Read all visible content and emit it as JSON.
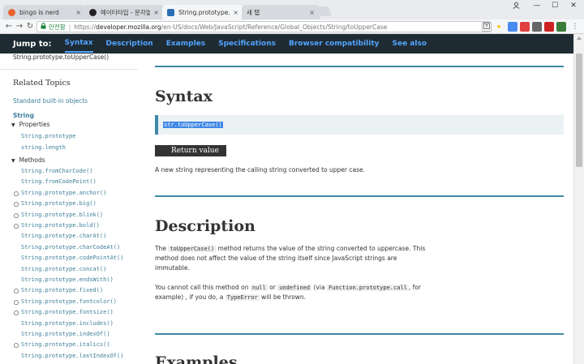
{
  "browser": {
    "tabs": [
      {
        "title": "bingo is nerd",
        "favicon_color": "#e8622c",
        "active": false
      },
      {
        "title": "메이터타입 - 문자열과",
        "favicon_color": "#222222",
        "active": false
      },
      {
        "title": "String.prototype.toUppe",
        "favicon_color": "#2a6eb5",
        "active": true
      },
      {
        "title": "새 탭",
        "favicon_color": "",
        "active": false
      }
    ],
    "tab_close": "×",
    "window_controls": {
      "minimize": "—",
      "maximize": "☐",
      "close": "✕"
    },
    "nav": {
      "back": "←",
      "forward": "→",
      "reload": "↻"
    },
    "address": {
      "secure_label": "안전함",
      "separator": "|",
      "scheme": "https://",
      "host": "developer.mozilla.org",
      "path": "/en-US/docs/Web/JavaScript/Reference/Global_Objects/String/toUpperCase"
    }
  },
  "jumpbar": {
    "label": "Jump to:",
    "links": [
      "Syntax",
      "Description",
      "Examples",
      "Specifications",
      "Browser compatibility",
      "See also"
    ]
  },
  "sidebar": {
    "breadcrumb_tail": "String.prototype.toUpperCase()",
    "related_title": "Related Topics",
    "standard_link": "Standard built-in objects",
    "object_name": "String",
    "properties_label": "Properties",
    "properties": [
      "String.prototype",
      "string.length"
    ],
    "methods_label": "Methods",
    "methods": [
      {
        "name": "String.fromCharCode()",
        "warn": false
      },
      {
        "name": "String.fromCodePoint()",
        "warn": false
      },
      {
        "name": "String.prototype.anchor()",
        "warn": true
      },
      {
        "name": "String.prototype.big()",
        "warn": true
      },
      {
        "name": "String.prototype.blink()",
        "warn": true
      },
      {
        "name": "String.prototype.bold()",
        "warn": true
      },
      {
        "name": "String.prototype.charAt()",
        "warn": false
      },
      {
        "name": "String.prototype.charCodeAt()",
        "warn": false
      },
      {
        "name": "String.prototype.codePointAt()",
        "warn": false
      },
      {
        "name": "String.prototype.concat()",
        "warn": false
      },
      {
        "name": "String.prototype.endsWith()",
        "warn": false
      },
      {
        "name": "String.prototype.fixed()",
        "warn": true
      },
      {
        "name": "String.prototype.fontcolor()",
        "warn": true
      },
      {
        "name": "String.prototype.fontsize()",
        "warn": true
      },
      {
        "name": "String.prototype.includes()",
        "warn": false
      },
      {
        "name": "String.prototype.indexOf()",
        "warn": false
      },
      {
        "name": "String.prototype.italics()",
        "warn": true
      },
      {
        "name": "String.prototype.lastIndexOf()",
        "warn": false
      }
    ]
  },
  "main": {
    "syntax_heading": "Syntax",
    "syntax_code": "str.toUpperCase()",
    "return_heading": "Return value",
    "return_text": "A new string representing the calling string converted to upper case.",
    "description_heading": "Description",
    "desc_p1_a": "The ",
    "desc_p1_code": "toUpperCase()",
    "desc_p1_b": " method returns the value of the string converted to uppercase. This method does not affect the value of the string itself since JavaScript strings are immutable.",
    "desc_p2_a": "You cannot call this method on ",
    "desc_p2_code1": "null",
    "desc_p2_b": " or ",
    "desc_p2_code2": "undefined",
    "desc_p2_c": " (via ",
    "desc_p2_code3": "Function.prototype.call",
    "desc_p2_d": ", for example) , if you do, a ",
    "desc_p2_code4": "TypeError",
    "desc_p2_e": " will be thrown.",
    "examples_heading": "Examples"
  }
}
